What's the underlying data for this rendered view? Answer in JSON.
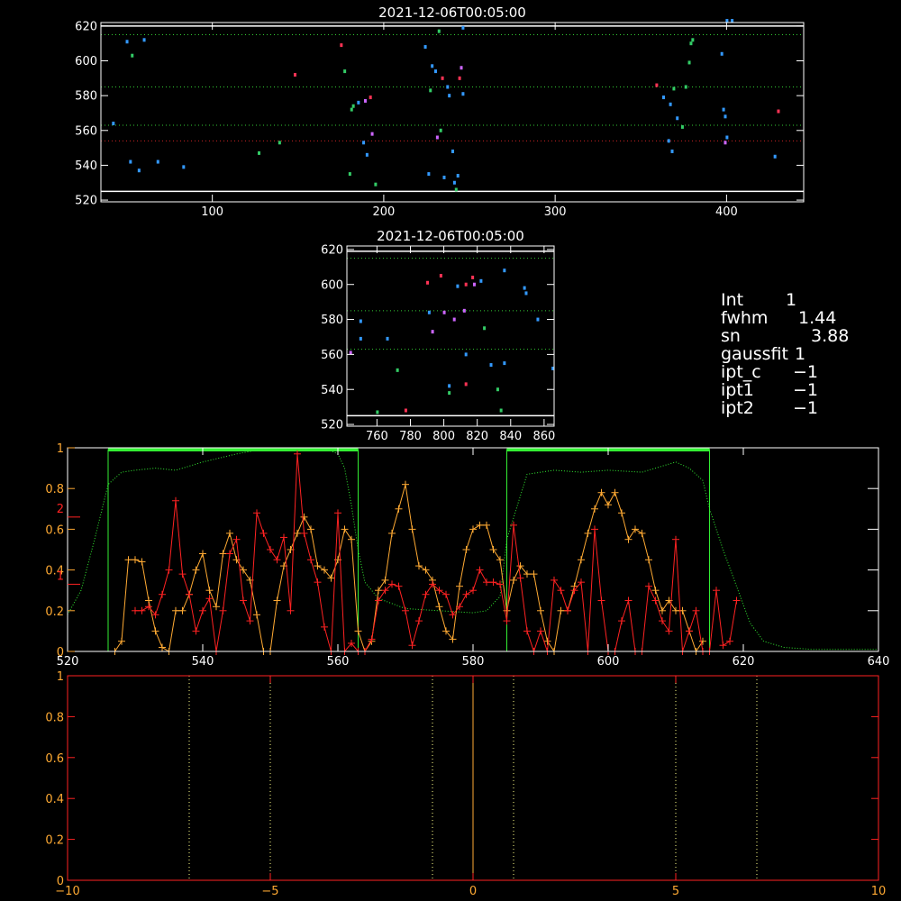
{
  "chart_data": [
    {
      "id": "top-scatter",
      "type": "scatter",
      "title": "2021-12-06T00:05:00",
      "xlim": [
        35,
        445
      ],
      "ylim": [
        519,
        622
      ],
      "xticks": [
        100,
        200,
        300,
        400
      ],
      "yticks": [
        520,
        540,
        560,
        580,
        600,
        620
      ],
      "hlines": [
        {
          "y": 620,
          "color": "#ffffff",
          "style": "solid"
        },
        {
          "y": 525,
          "color": "#ffffff",
          "style": "solid"
        },
        {
          "y": 615,
          "color": "#33cc33",
          "style": "dotted"
        },
        {
          "y": 585,
          "color": "#33cc33",
          "style": "dotted"
        },
        {
          "y": 563,
          "color": "#33cc33",
          "style": "dotted"
        },
        {
          "y": 554,
          "color": "#cc2222",
          "style": "dotted"
        }
      ],
      "points": [
        [
          42,
          564,
          "#3399ff"
        ],
        [
          50,
          611,
          "#3399ff"
        ],
        [
          53,
          603,
          "#33cc66"
        ],
        [
          60,
          612,
          "#3399ff"
        ],
        [
          52,
          542,
          "#3399ff"
        ],
        [
          57,
          537,
          "#3399ff"
        ],
        [
          68,
          542,
          "#3399ff"
        ],
        [
          83,
          539,
          "#3399ff"
        ],
        [
          127,
          547,
          "#33cc66"
        ],
        [
          139,
          553,
          "#33cc66"
        ],
        [
          148,
          592,
          "#ff3355"
        ],
        [
          175,
          609,
          "#ff3355"
        ],
        [
          177,
          594,
          "#33cc66"
        ],
        [
          180,
          535,
          "#33cc66"
        ],
        [
          181,
          572,
          "#33cc66"
        ],
        [
          182,
          574,
          "#33cc66"
        ],
        [
          185,
          576,
          "#3399ff"
        ],
        [
          188,
          553,
          "#3399ff"
        ],
        [
          189,
          577,
          "#cc66ff"
        ],
        [
          190,
          546,
          "#3399ff"
        ],
        [
          192,
          579,
          "#ff3355"
        ],
        [
          193,
          558,
          "#cc66ff"
        ],
        [
          195,
          529,
          "#33cc66"
        ],
        [
          224,
          608,
          "#3399ff"
        ],
        [
          226,
          535,
          "#3399ff"
        ],
        [
          227,
          583,
          "#33cc66"
        ],
        [
          228,
          597,
          "#3399ff"
        ],
        [
          230,
          594,
          "#3399ff"
        ],
        [
          231,
          556,
          "#cc66ff"
        ],
        [
          232,
          617,
          "#33cc66"
        ],
        [
          233,
          560,
          "#33cc66"
        ],
        [
          234,
          590,
          "#ff3355"
        ],
        [
          235,
          533,
          "#3399ff"
        ],
        [
          237,
          585,
          "#3399ff"
        ],
        [
          238,
          580,
          "#3399ff"
        ],
        [
          240,
          548,
          "#3399ff"
        ],
        [
          241,
          530,
          "#3399ff"
        ],
        [
          242,
          526,
          "#33cc66"
        ],
        [
          243,
          534,
          "#3399ff"
        ],
        [
          244,
          590,
          "#ff3355"
        ],
        [
          245,
          596,
          "#cc66ff"
        ],
        [
          246,
          581,
          "#3399ff"
        ],
        [
          246,
          619,
          "#3399ff"
        ],
        [
          359,
          586,
          "#ff3355"
        ],
        [
          363,
          579,
          "#3399ff"
        ],
        [
          366,
          554,
          "#3399ff"
        ],
        [
          367,
          575,
          "#3399ff"
        ],
        [
          368,
          548,
          "#3399ff"
        ],
        [
          369,
          584,
          "#33cc66"
        ],
        [
          371,
          567,
          "#3399ff"
        ],
        [
          374,
          562,
          "#33cc66"
        ],
        [
          376,
          585,
          "#33cc66"
        ],
        [
          378,
          599,
          "#33cc66"
        ],
        [
          379,
          610,
          "#33cc66"
        ],
        [
          380,
          612,
          "#33cc66"
        ],
        [
          397,
          604,
          "#3399ff"
        ],
        [
          398,
          572,
          "#3399ff"
        ],
        [
          399,
          568,
          "#3399ff"
        ],
        [
          399,
          553,
          "#cc66ff"
        ],
        [
          400,
          556,
          "#3399ff"
        ],
        [
          400,
          623,
          "#3399ff"
        ],
        [
          403,
          623,
          "#3399ff"
        ],
        [
          428,
          545,
          "#3399ff"
        ],
        [
          430,
          571,
          "#ff3355"
        ]
      ]
    },
    {
      "id": "middle-scatter",
      "type": "scatter",
      "title": "2021-12-06T00:05:00",
      "xlim": [
        742,
        866
      ],
      "ylim": [
        519,
        622
      ],
      "xticks": [
        760,
        780,
        800,
        820,
        840,
        860
      ],
      "yticks": [
        520,
        540,
        560,
        580,
        600,
        620
      ],
      "hlines": [
        {
          "y": 619,
          "color": "#ffffff",
          "style": "solid"
        },
        {
          "y": 525,
          "color": "#ffffff",
          "style": "solid"
        },
        {
          "y": 615,
          "color": "#33cc33",
          "style": "dotted"
        },
        {
          "y": 585,
          "color": "#33cc33",
          "style": "dotted"
        },
        {
          "y": 563,
          "color": "#33cc33",
          "style": "dotted"
        }
      ],
      "points": [
        [
          744,
          561,
          "#cc66ff"
        ],
        [
          750,
          579,
          "#3399ff"
        ],
        [
          750,
          569,
          "#3399ff"
        ],
        [
          760,
          527,
          "#33cc66"
        ],
        [
          766,
          569,
          "#3399ff"
        ],
        [
          772,
          551,
          "#33cc66"
        ],
        [
          777,
          528,
          "#ff3355"
        ],
        [
          790,
          601,
          "#ff3355"
        ],
        [
          791,
          584,
          "#3399ff"
        ],
        [
          793,
          573,
          "#cc66ff"
        ],
        [
          798,
          605,
          "#ff3355"
        ],
        [
          800,
          584,
          "#cc66ff"
        ],
        [
          803,
          542,
          "#3399ff"
        ],
        [
          803,
          538,
          "#33cc66"
        ],
        [
          806,
          580,
          "#cc66ff"
        ],
        [
          808,
          599,
          "#3399ff"
        ],
        [
          812,
          585,
          "#cc66ff"
        ],
        [
          813,
          543,
          "#ff3355"
        ],
        [
          813,
          560,
          "#3399ff"
        ],
        [
          813,
          600,
          "#ff3355"
        ],
        [
          817,
          604,
          "#ff3355"
        ],
        [
          818,
          600,
          "#cc66ff"
        ],
        [
          822,
          602,
          "#3399ff"
        ],
        [
          824,
          575,
          "#33cc66"
        ],
        [
          828,
          554,
          "#3399ff"
        ],
        [
          832,
          540,
          "#33cc66"
        ],
        [
          834,
          528,
          "#33cc66"
        ],
        [
          836,
          608,
          "#3399ff"
        ],
        [
          836,
          555,
          "#3399ff"
        ],
        [
          848,
          598,
          "#3399ff"
        ],
        [
          849,
          595,
          "#3399ff"
        ],
        [
          856,
          580,
          "#3399ff"
        ],
        [
          865,
          552,
          "#3399ff"
        ]
      ]
    },
    {
      "id": "spectrum-plot",
      "type": "line",
      "xlim": [
        520,
        640
      ],
      "ylim": [
        0,
        1
      ],
      "xticks": [
        520,
        540,
        560,
        580,
        600,
        620,
        640
      ],
      "yticks": [
        0.0,
        0.2,
        0.4,
        0.6,
        0.8,
        1.0
      ],
      "left_secondary_ticks": [
        {
          "label": "2",
          "value": 0.66
        },
        {
          "label": "1",
          "value": 0.33
        }
      ],
      "bands": [
        {
          "x0": 526,
          "x1": 563,
          "color": "#33ee33"
        },
        {
          "x0": 585,
          "x1": 615,
          "color": "#33ee33"
        }
      ],
      "series": [
        {
          "id": "green-profile",
          "style": "dotted",
          "color": "#33ee33",
          "x": [
            520,
            522,
            524,
            526,
            528,
            530,
            533,
            536,
            540,
            545,
            550,
            555,
            558,
            560,
            561,
            562,
            563,
            564,
            566,
            570,
            575,
            580,
            582,
            584,
            585,
            588,
            592,
            596,
            600,
            605,
            610,
            612,
            614,
            615,
            617,
            619,
            621,
            623,
            626,
            630,
            635,
            640
          ],
          "y": [
            0.18,
            0.3,
            0.55,
            0.82,
            0.88,
            0.89,
            0.9,
            0.89,
            0.93,
            0.97,
            1.0,
            0.99,
            1.0,
            0.97,
            0.9,
            0.72,
            0.5,
            0.34,
            0.26,
            0.21,
            0.2,
            0.19,
            0.2,
            0.27,
            0.55,
            0.87,
            0.89,
            0.88,
            0.89,
            0.88,
            0.93,
            0.9,
            0.84,
            0.7,
            0.5,
            0.32,
            0.14,
            0.05,
            0.02,
            0.01,
            0.01,
            0.01
          ]
        },
        {
          "id": "orange-series",
          "style": "solid",
          "color": "#ffaa33",
          "marker": "plus",
          "x": [
            527,
            528,
            529,
            530,
            531,
            532,
            533,
            534,
            535,
            536,
            537,
            538,
            539,
            540,
            541,
            542,
            543,
            544,
            545,
            546,
            547,
            548,
            549,
            550,
            551,
            552,
            553,
            554,
            555,
            556,
            557,
            558,
            559,
            560,
            561,
            562,
            563,
            564,
            565,
            566,
            567,
            568,
            569,
            570,
            571,
            572,
            573,
            574,
            575,
            576,
            577,
            578,
            579,
            580,
            581,
            582,
            583,
            584,
            585,
            586,
            587,
            588,
            589,
            590,
            591,
            592,
            593,
            594,
            595,
            596,
            597,
            598,
            599,
            600,
            601,
            602,
            603,
            604,
            605,
            606,
            607,
            608,
            609,
            610,
            611,
            612,
            613,
            614
          ],
          "y": [
            0.0,
            0.05,
            0.45,
            0.45,
            0.44,
            0.25,
            0.1,
            0.02,
            0.0,
            0.2,
            0.2,
            0.28,
            0.4,
            0.48,
            0.3,
            0.22,
            0.48,
            0.58,
            0.45,
            0.4,
            0.35,
            0.18,
            0.0,
            0.0,
            0.25,
            0.42,
            0.5,
            0.58,
            0.66,
            0.6,
            0.42,
            0.4,
            0.36,
            0.45,
            0.6,
            0.55,
            0.1,
            0.0,
            0.05,
            0.3,
            0.35,
            0.58,
            0.7,
            0.82,
            0.6,
            0.42,
            0.4,
            0.35,
            0.22,
            0.1,
            0.06,
            0.32,
            0.5,
            0.6,
            0.62,
            0.62,
            0.5,
            0.45,
            0.2,
            0.35,
            0.42,
            0.38,
            0.38,
            0.2,
            0.05,
            0.0,
            0.2,
            0.2,
            0.32,
            0.45,
            0.58,
            0.7,
            0.78,
            0.72,
            0.78,
            0.68,
            0.55,
            0.6,
            0.58,
            0.45,
            0.3,
            0.2,
            0.25,
            0.2,
            0.2,
            0.1,
            0.0,
            0.05
          ]
        },
        {
          "id": "red-series",
          "style": "solid",
          "color": "#ff2222",
          "marker": "plus",
          "x": [
            530,
            531,
            532,
            533,
            534,
            535,
            536,
            537,
            538,
            539,
            540,
            541,
            542,
            543,
            544,
            545,
            546,
            547,
            548,
            549,
            550,
            551,
            552,
            553,
            554,
            555,
            556,
            557,
            558,
            559,
            560,
            561,
            562,
            563,
            564,
            565,
            566,
            567,
            568,
            569,
            570,
            571,
            572,
            573,
            574,
            575,
            576,
            577,
            578,
            579,
            580,
            581,
            582,
            583,
            584,
            585,
            586,
            587,
            588,
            589,
            590,
            591,
            592,
            593,
            594,
            595,
            596,
            597,
            598,
            599,
            600,
            601,
            602,
            603,
            604,
            605,
            606,
            607,
            608,
            609,
            610,
            611,
            612,
            613,
            614,
            615,
            616,
            617,
            618,
            619
          ],
          "y": [
            0.2,
            0.2,
            0.22,
            0.18,
            0.28,
            0.4,
            0.74,
            0.38,
            0.28,
            0.1,
            0.2,
            0.26,
            0.0,
            0.2,
            0.48,
            0.55,
            0.25,
            0.15,
            0.68,
            0.58,
            0.5,
            0.45,
            0.56,
            0.2,
            0.97,
            0.58,
            0.45,
            0.34,
            0.12,
            0.0,
            0.68,
            0.0,
            0.04,
            0.0,
            0.0,
            0.06,
            0.25,
            0.3,
            0.33,
            0.32,
            0.2,
            0.03,
            0.15,
            0.28,
            0.33,
            0.3,
            0.28,
            0.18,
            0.22,
            0.28,
            0.3,
            0.4,
            0.34,
            0.34,
            0.33,
            0.15,
            0.62,
            0.36,
            0.1,
            0.0,
            0.1,
            0.0,
            0.35,
            0.3,
            0.2,
            0.3,
            0.34,
            0.0,
            0.6,
            0.25,
            0.0,
            0.0,
            0.15,
            0.25,
            0.0,
            0.0,
            0.32,
            0.25,
            0.15,
            0.1,
            0.55,
            0.0,
            0.1,
            0.2,
            0.0,
            0.0,
            0.3,
            0.03,
            0.05,
            0.25
          ]
        }
      ]
    },
    {
      "id": "bottom-plot",
      "type": "line",
      "xlim": [
        -10,
        10
      ],
      "ylim": [
        0,
        1
      ],
      "xticks": [
        -10,
        -5,
        0,
        5,
        10
      ],
      "yticks": [
        0.0,
        0.2,
        0.4,
        0.6,
        0.8,
        1.0
      ],
      "vlines": [
        {
          "x": -7,
          "color": "#ffff88",
          "style": "dotted"
        },
        {
          "x": -5,
          "color": "#ffff88",
          "style": "dotted"
        },
        {
          "x": -1,
          "color": "#ffff88",
          "style": "dotted"
        },
        {
          "x": 1,
          "color": "#ffff88",
          "style": "dotted"
        },
        {
          "x": 5,
          "color": "#ffff88",
          "style": "dotted"
        },
        {
          "x": 7,
          "color": "#ffff88",
          "style": "dotted"
        },
        {
          "x": 0,
          "color": "#ffaa33",
          "style": "solid"
        }
      ]
    }
  ],
  "info_panel": {
    "rows": [
      {
        "key": "Int",
        "value": "1"
      },
      {
        "key": "fwhm",
        "value": "1.44"
      },
      {
        "key": "sn",
        "value": "3.88"
      },
      {
        "key": "gaussfit",
        "value": "1"
      },
      {
        "key": "ipt_c",
        "value": "−1"
      },
      {
        "key": "ipt1",
        "value": "−1"
      },
      {
        "key": "ipt2",
        "value": "−1"
      }
    ]
  }
}
